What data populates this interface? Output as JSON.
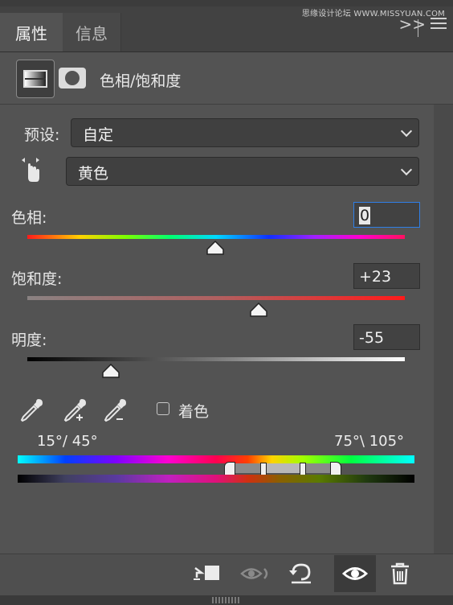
{
  "watermark": "思缘设计论坛 WWW.MISSYUAN.COM",
  "tabs": [
    {
      "label": "属性",
      "active": true
    },
    {
      "label": "信息",
      "active": false
    }
  ],
  "tab_collapse": ">>",
  "header": {
    "title": "色相/饱和度"
  },
  "preset": {
    "label": "预设:",
    "value": "自定"
  },
  "channel": {
    "value": "黄色"
  },
  "hue": {
    "label": "色相:",
    "value": "0"
  },
  "saturation": {
    "label": "饱和度:",
    "value": "+23"
  },
  "lightness": {
    "label": "明度:",
    "value": "-55"
  },
  "colorize": {
    "label": "着色",
    "checked": false
  },
  "range": {
    "left": "15°/ 45°",
    "right": "75°\\ 105°"
  },
  "colors": {
    "accent": "#1f6fd1",
    "panel": "#535353",
    "dark": "#424242"
  },
  "icons": [
    "targeted-adjust-hand-icon",
    "eyedropper-icon",
    "eyedropper-plus-icon",
    "eyedropper-minus-icon",
    "clip-to-layer-icon",
    "view-previous-icon",
    "reset-icon",
    "visibility-eye-icon",
    "trash-icon"
  ]
}
